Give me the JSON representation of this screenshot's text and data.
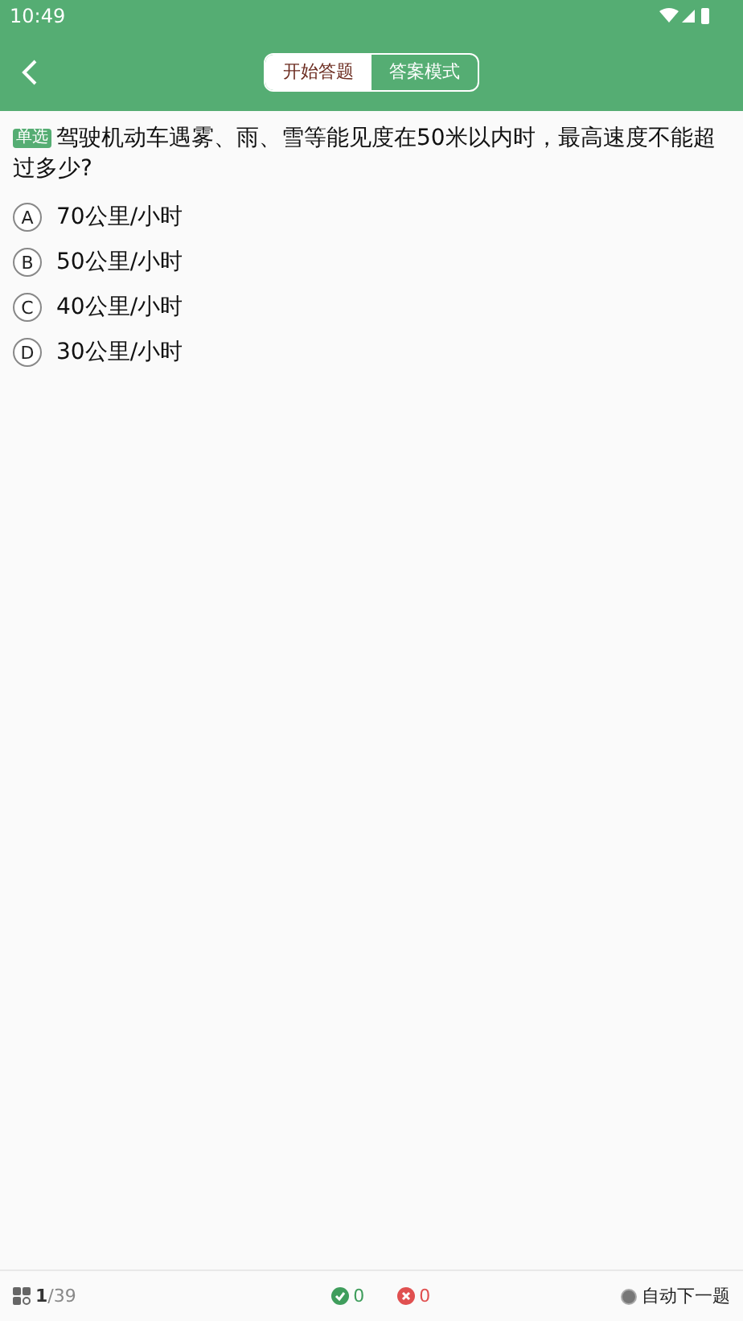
{
  "status_bar": {
    "time": "10:49"
  },
  "header": {
    "tabs": [
      {
        "label": "开始答题",
        "selected": true
      },
      {
        "label": "答案模式",
        "selected": false
      }
    ]
  },
  "question": {
    "type_badge": "单选",
    "text": "驾驶机动车遇雾、雨、雪等能见度在50米以内时，最高速度不能超过多少?"
  },
  "options": [
    {
      "letter": "A",
      "text": "70公里/小时",
      "selected": false
    },
    {
      "letter": "B",
      "text": "50公里/小时",
      "selected": false
    },
    {
      "letter": "C",
      "text": "40公里/小时",
      "selected": false
    },
    {
      "letter": "D",
      "text": "30公里/小时",
      "selected": false
    }
  ],
  "footer": {
    "progress": "**1**/39",
    "correct": "0",
    "wrong": "0",
    "auto_next": {
      "label": "自动下一题",
      "on": false
    }
  }
}
